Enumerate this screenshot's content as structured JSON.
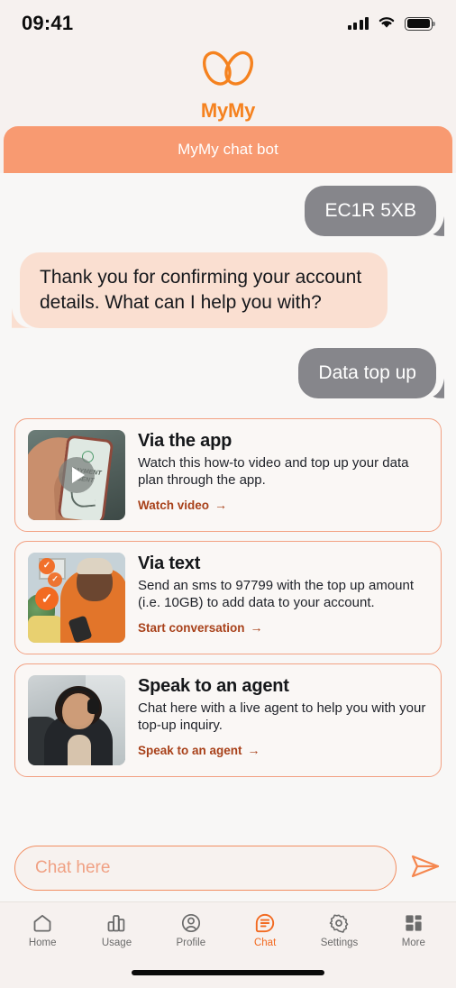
{
  "status_bar": {
    "time": "09:41",
    "signal_icon": "signal-bars-icon",
    "wifi_icon": "wifi-icon",
    "battery_icon": "battery-full-icon"
  },
  "brand": {
    "logo_icon": "mymy-logo-icon",
    "wordmark": "MyMy",
    "color": "#f5821f"
  },
  "chat_header": {
    "title": "MyMy chat bot",
    "background": "#f89a71"
  },
  "conversation": {
    "messages": [
      {
        "id": "user-postcode",
        "sender": "user",
        "text": "EC1R 5XB"
      },
      {
        "id": "bot-greeting",
        "sender": "bot",
        "text": "Thank you for confirming your account details. What can I help you with?"
      },
      {
        "id": "user-request",
        "sender": "user",
        "text": "Data top up"
      }
    ],
    "user_bubble_color": "#86868b",
    "bot_bubble_color": "#fadfd1"
  },
  "option_cards": [
    {
      "id": "via-the-app",
      "title": "Via the app",
      "description": "Watch this how-to video and top up your data plan through the app.",
      "link_label": "Watch video",
      "link_arrow": "→",
      "thumbnail_alt": "hand-holding-phone-payment-sent",
      "has_play_button": true,
      "badge_check": "✓"
    },
    {
      "id": "via-text",
      "title": "Via text",
      "description": "Send an sms to 97799 with the top up amount (i.e. 10GB) to add data to your account.",
      "link_label": "Start conversation",
      "link_arrow": "→",
      "thumbnail_alt": "woman-texting-with-check-badges",
      "has_play_button": false,
      "badge_check": "✓"
    },
    {
      "id": "speak-to-an-agent",
      "title": "Speak to an agent",
      "description": "Chat here with a live agent to help you with your top-up inquiry.",
      "link_label": "Speak to an agent",
      "link_arrow": "→",
      "thumbnail_alt": "call-centre-agent-with-headset",
      "has_play_button": false,
      "badge_check": "✓"
    }
  ],
  "composer": {
    "placeholder": "Chat here",
    "value": "",
    "send_icon": "send-paper-plane-icon",
    "border_color": "#f28e62"
  },
  "tab_bar": {
    "active_color": "#f26a21",
    "inactive_color": "#6b6b6b",
    "items": [
      {
        "id": "home",
        "label": "Home",
        "icon": "home-icon",
        "active": false
      },
      {
        "id": "usage",
        "label": "Usage",
        "icon": "bar-chart-icon",
        "active": false
      },
      {
        "id": "profile",
        "label": "Profile",
        "icon": "person-circle-icon",
        "active": false
      },
      {
        "id": "chat",
        "label": "Chat",
        "icon": "chat-bubble-icon",
        "active": true
      },
      {
        "id": "settings",
        "label": "Settings",
        "icon": "gear-icon",
        "active": false
      },
      {
        "id": "more",
        "label": "More",
        "icon": "grid-icon",
        "active": false
      }
    ]
  },
  "home_indicator": {
    "name": "home-indicator"
  }
}
